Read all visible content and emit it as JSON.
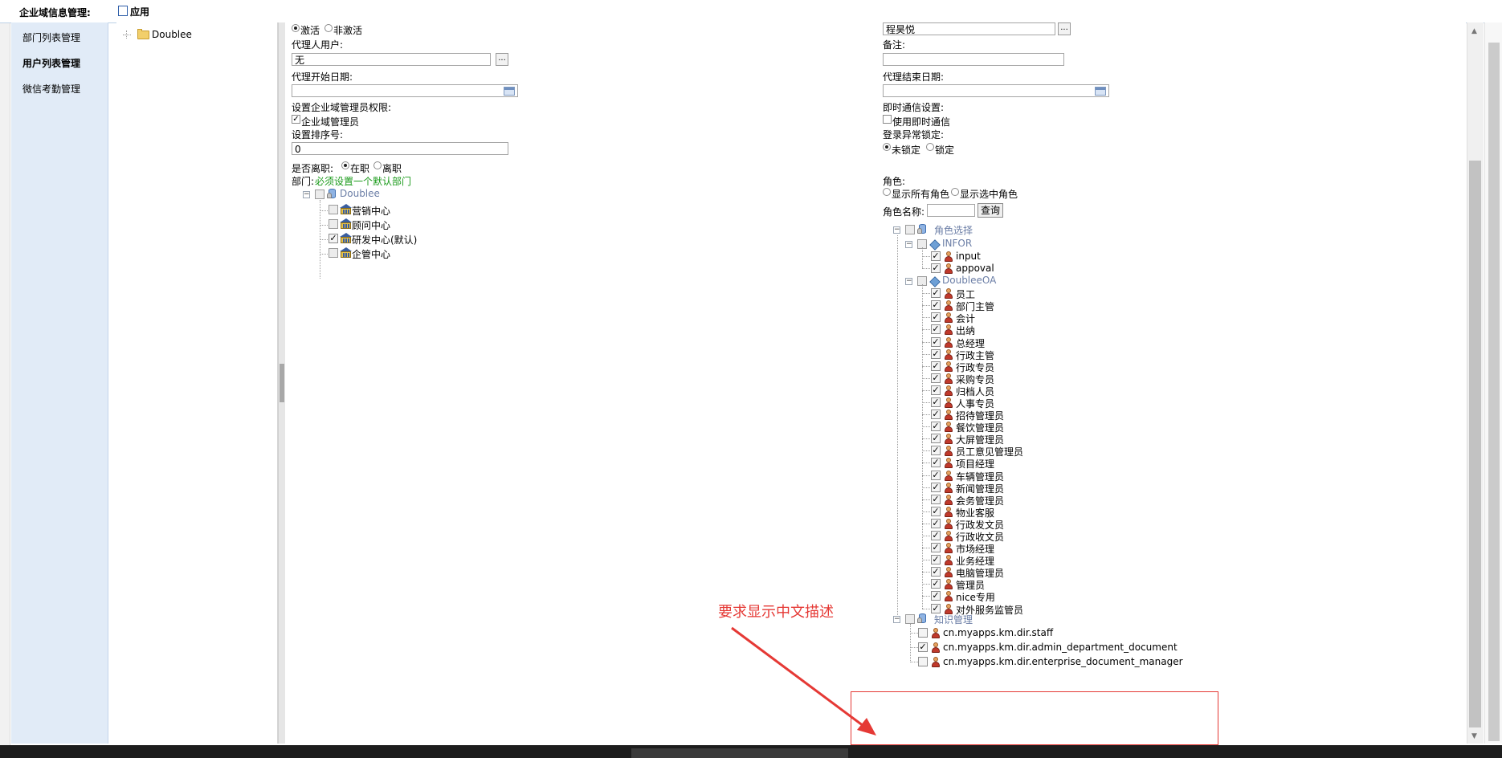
{
  "header": {
    "title": "企业域信息管理:",
    "apply_label": "应用"
  },
  "sidebar": {
    "items": [
      {
        "label": "部门列表管理",
        "active": false
      },
      {
        "label": "用户列表管理",
        "active": true
      },
      {
        "label": "微信考勤管理",
        "active": false
      }
    ]
  },
  "tree_panel": {
    "root": "Doublee"
  },
  "form": {
    "status": {
      "active_label": "激活",
      "inactive_label": "非激活",
      "selected": "激活"
    },
    "agent_user": {
      "label": "代理人用户:",
      "value": "无",
      "browse": "..."
    },
    "agent_start": {
      "label": "代理开始日期:",
      "value": ""
    },
    "admin_rights": {
      "label": "设置企业域管理员权限:",
      "checkbox_label": "企业域管理员",
      "checked": true
    },
    "sort_no": {
      "label": "设置排序号:",
      "value": "0"
    },
    "resigned": {
      "label": "是否离职:",
      "on_label": "在职",
      "off_label": "离职",
      "selected": "在职"
    },
    "dept": {
      "label": "部门:",
      "hint": "必须设置一个默认部门"
    },
    "dept_tree": {
      "root": "Doublee",
      "children": [
        {
          "label": "营销中心",
          "checked": false
        },
        {
          "label": "顾问中心",
          "checked": false
        },
        {
          "label": "研发中心(默认)",
          "checked": true
        },
        {
          "label": "企管中心",
          "checked": false
        }
      ]
    },
    "user_name": {
      "value": "程昊悦",
      "browse": "..."
    },
    "remark": {
      "label": "备注:",
      "value": ""
    },
    "agent_end": {
      "label": "代理结束日期:",
      "value": ""
    },
    "im": {
      "label": "即时通信设置:",
      "checkbox_label": "使用即时通信",
      "checked": false
    },
    "login_lock": {
      "label": "登录异常锁定:",
      "unlocked_label": "未锁定",
      "locked_label": "锁定",
      "selected": "未锁定"
    },
    "role": {
      "label": "角色:",
      "show_all": "显示所有角色",
      "show_selected": "显示选中角色"
    },
    "role_name": {
      "label": "角色名称:",
      "value": "",
      "query_button": "查询"
    },
    "role_tree": {
      "root": "角色选择",
      "groups": [
        {
          "name": "INFOR",
          "items": [
            {
              "label": "input",
              "checked": true
            },
            {
              "label": "appoval",
              "checked": true
            }
          ]
        },
        {
          "name": "DoubleeOA",
          "items": [
            {
              "label": "员工",
              "checked": true
            },
            {
              "label": "部门主管",
              "checked": true
            },
            {
              "label": "会计",
              "checked": true
            },
            {
              "label": "出纳",
              "checked": true
            },
            {
              "label": "总经理",
              "checked": true
            },
            {
              "label": "行政主管",
              "checked": true
            },
            {
              "label": "行政专员",
              "checked": true
            },
            {
              "label": "采购专员",
              "checked": true
            },
            {
              "label": "归档人员",
              "checked": true
            },
            {
              "label": "人事专员",
              "checked": true
            },
            {
              "label": "招待管理员",
              "checked": true
            },
            {
              "label": "餐饮管理员",
              "checked": true
            },
            {
              "label": "大屏管理员",
              "checked": true
            },
            {
              "label": "员工意见管理员",
              "checked": true
            },
            {
              "label": "项目经理",
              "checked": true
            },
            {
              "label": "车辆管理员",
              "checked": true
            },
            {
              "label": "新闻管理员",
              "checked": true
            },
            {
              "label": "会务管理员",
              "checked": true
            },
            {
              "label": "物业客服",
              "checked": true
            },
            {
              "label": "行政发文员",
              "checked": true
            },
            {
              "label": "行政收文员",
              "checked": true
            },
            {
              "label": "市场经理",
              "checked": true
            },
            {
              "label": "业务经理",
              "checked": true
            },
            {
              "label": "电脑管理员",
              "checked": true
            },
            {
              "label": "管理员",
              "checked": true
            },
            {
              "label": "nice专用",
              "checked": true
            },
            {
              "label": "对外服务监管员",
              "checked": true
            }
          ]
        }
      ],
      "km_root": "知识管理",
      "km_items": [
        {
          "label": "cn.myapps.km.dir.staff",
          "checked": false
        },
        {
          "label": "cn.myapps.km.dir.admin_department_document",
          "checked": true
        },
        {
          "label": "cn.myapps.km.dir.enterprise_document_manager",
          "checked": false
        }
      ]
    }
  },
  "annotation": {
    "text": "要求显示中文描述",
    "color": "#e53935"
  },
  "colors": {
    "sidebar_bg": "#e1ebf7",
    "hint_green": "#1a9a1a",
    "tree_text": "#6b7ea6"
  }
}
